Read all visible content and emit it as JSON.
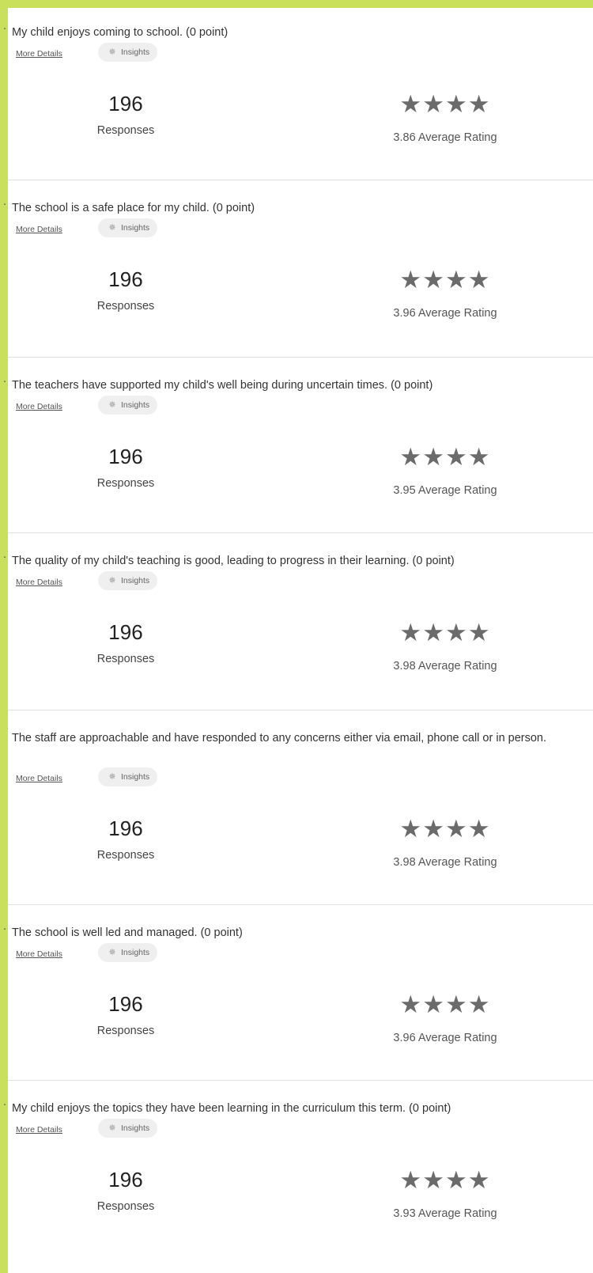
{
  "common": {
    "more_details_label": "More Details",
    "insights_label": "Insights",
    "responses_label": "Responses",
    "average_rating_suffix": "Average Rating",
    "star_glyphs": "★★★★"
  },
  "questions": [
    {
      "number_fragment": ".",
      "text": "My child enjoys coming to school.  (0 point)",
      "responses": "196",
      "average_rating": "3.86 Average Rating",
      "rating_value": 3.86
    },
    {
      "number_fragment": ".",
      "text": "The school is a safe place for my child.  (0 point)",
      "responses": "196",
      "average_rating": "3.96 Average Rating",
      "rating_value": 3.96
    },
    {
      "number_fragment": ".",
      "text": "The teachers have supported my child's well being during uncertain times.  (0 point)",
      "responses": "196",
      "average_rating": "3.95 Average Rating",
      "rating_value": 3.95
    },
    {
      "number_fragment": ".",
      "text": "The quality of my child's teaching is good, leading to progress in their learning. (0 point)",
      "responses": "196",
      "average_rating": "3.98 Average Rating",
      "rating_value": 3.98
    },
    {
      "number_fragment": ".",
      "text": "The staff are approachable and have responded to any concerns either via email, phone call or in person.",
      "responses": "196",
      "average_rating": "3.98 Average Rating",
      "rating_value": 3.98
    },
    {
      "number_fragment": ".",
      "text": "The school is well led and managed.  (0 point)",
      "responses": "196",
      "average_rating": "3.96 Average Rating",
      "rating_value": 3.96
    },
    {
      "number_fragment": ".",
      "text": "My child enjoys the topics they have been learning in the curriculum this term.  (0 point)",
      "responses": "196",
      "average_rating": "3.93 Average Rating",
      "rating_value": 3.93
    }
  ],
  "colors": {
    "page_background": "#c9e05c",
    "panel_background": "#ffffff",
    "star_color": "#6b6b6b",
    "divider_color": "#e1e1e1"
  }
}
